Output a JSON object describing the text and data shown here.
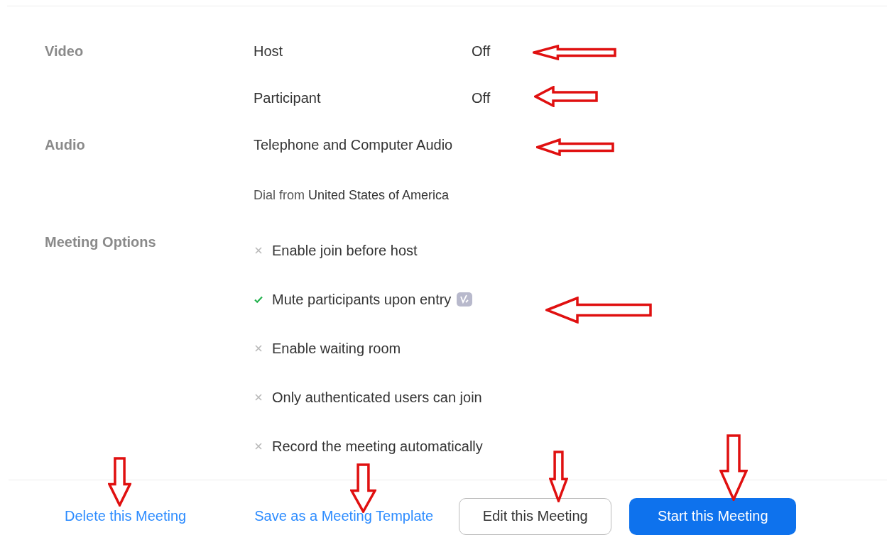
{
  "sections": [
    {
      "kind": "pairs",
      "label": "Video",
      "rows": [
        {
          "name": "Host",
          "value": "Off"
        },
        {
          "name": "Participant",
          "value": "Off"
        }
      ]
    },
    {
      "kind": "lines",
      "label": "Audio",
      "lines": [
        "Telephone and Computer Audio",
        "Dial from **United States of America**"
      ]
    },
    {
      "kind": "options",
      "label": "Meeting Options",
      "options": [
        {
          "label": "Enable join before host",
          "checked": false,
          "badge": false
        },
        {
          "label": "Mute participants upon entry",
          "checked": true,
          "badge": true
        },
        {
          "label": "Enable waiting room",
          "checked": false,
          "badge": false
        },
        {
          "label": "Only authenticated users can join",
          "checked": false,
          "badge": false
        },
        {
          "label": "Record the meeting automatically",
          "checked": false,
          "badge": false
        }
      ]
    }
  ],
  "actions": [
    {
      "kind": "link",
      "label": "Delete this Meeting"
    },
    {
      "kind": "link",
      "label": "Save as a Meeting Template"
    },
    {
      "kind": "outline",
      "label": "Edit this Meeting"
    },
    {
      "kind": "primary",
      "label": "Start this Meeting"
    }
  ],
  "annotations": [
    {
      "kind": "left-arrow"
    },
    {
      "kind": "left-arrow"
    },
    {
      "kind": "left-arrow"
    },
    {
      "kind": "left-arrow"
    },
    {
      "kind": "down-arrow"
    },
    {
      "kind": "down-arrow"
    },
    {
      "kind": "down-arrow"
    },
    {
      "kind": "down-arrow"
    }
  ]
}
